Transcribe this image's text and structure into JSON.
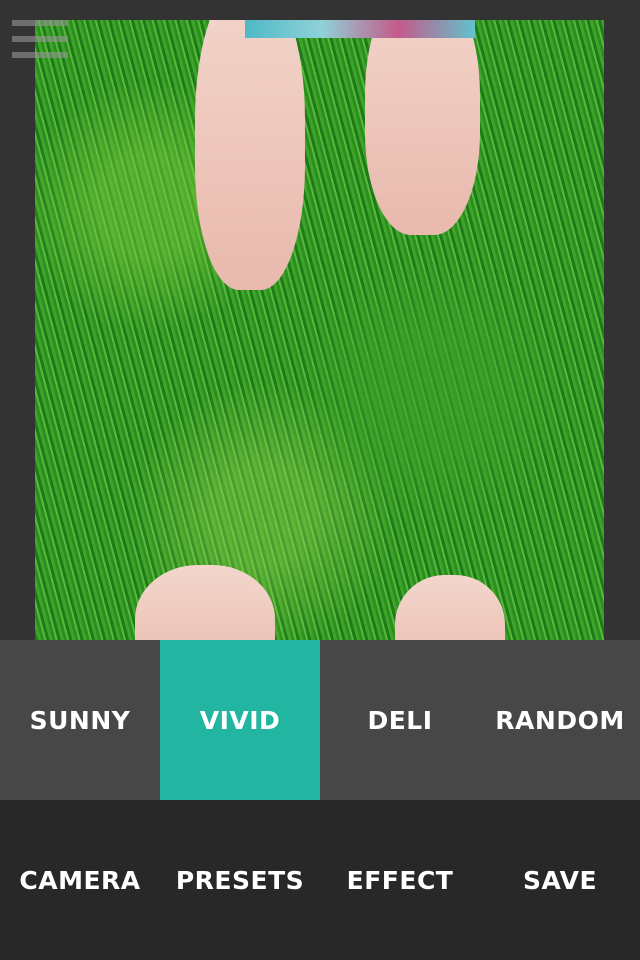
{
  "photo": {
    "description_icon": "photo-preview"
  },
  "menu": {
    "icon": "hamburger-menu-icon"
  },
  "filters": {
    "active_color": "#22b5a2",
    "items": [
      {
        "label": "SUNNY",
        "active": false
      },
      {
        "label": "VIVID",
        "active": true
      },
      {
        "label": "DELI",
        "active": false
      },
      {
        "label": "RANDOM",
        "active": false
      }
    ]
  },
  "nav": {
    "items": [
      {
        "label": "CAMERA"
      },
      {
        "label": "PRESETS"
      },
      {
        "label": "EFFECT"
      },
      {
        "label": "SAVE"
      }
    ]
  }
}
